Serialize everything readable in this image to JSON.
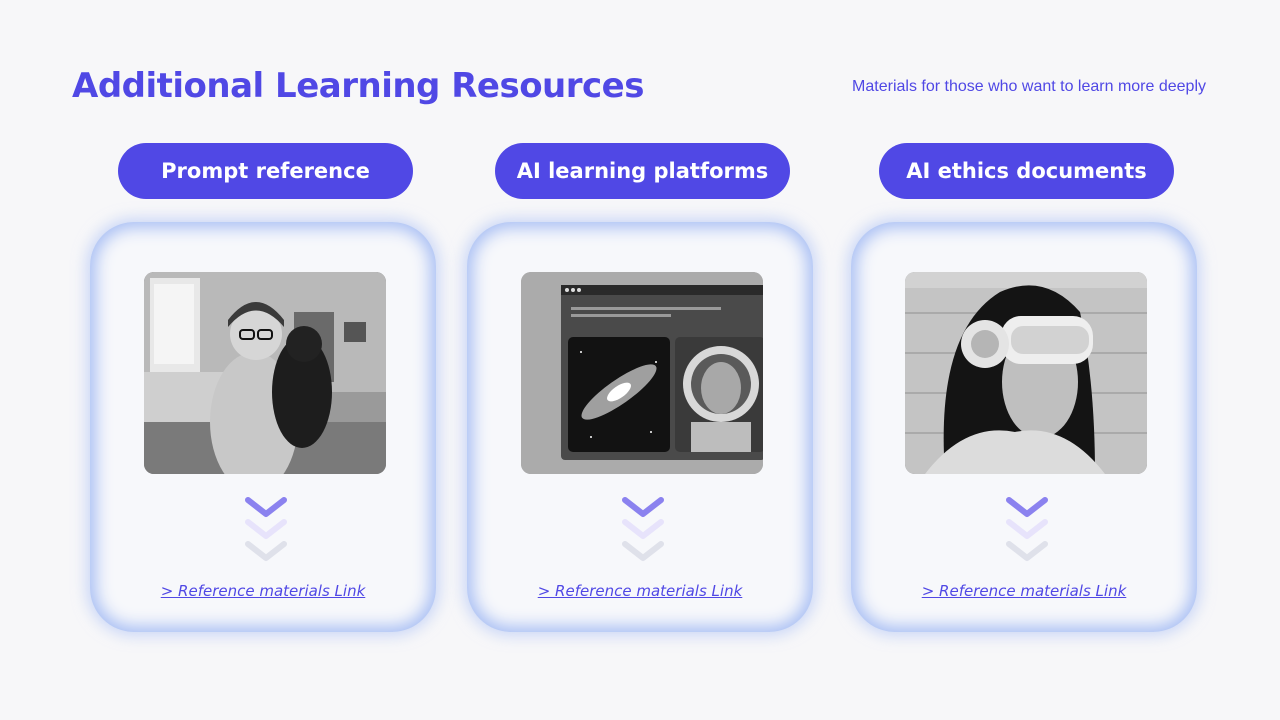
{
  "header": {
    "title": "Additional Learning Resources",
    "subtitle": "Materials for those who want to learn more deeply"
  },
  "cards": [
    {
      "heading": "Prompt reference",
      "image": "woman-holding-puppy-photo",
      "link": "> Reference materials Link"
    },
    {
      "heading": "AI learning platforms",
      "image": "ai-platform-screenshot-galaxy-astronaut",
      "screen_text": "Prompt: Here are some examples of image prompts and results, to pass information about what you want.",
      "link": "> Reference materials Link"
    },
    {
      "heading": "AI ethics documents",
      "image": "woman-vr-headset-photo",
      "link": "> Reference materials Link"
    }
  ],
  "colors": {
    "accent": "#5048e5",
    "glow": "#a9bff4",
    "background": "#f7f7f9"
  }
}
